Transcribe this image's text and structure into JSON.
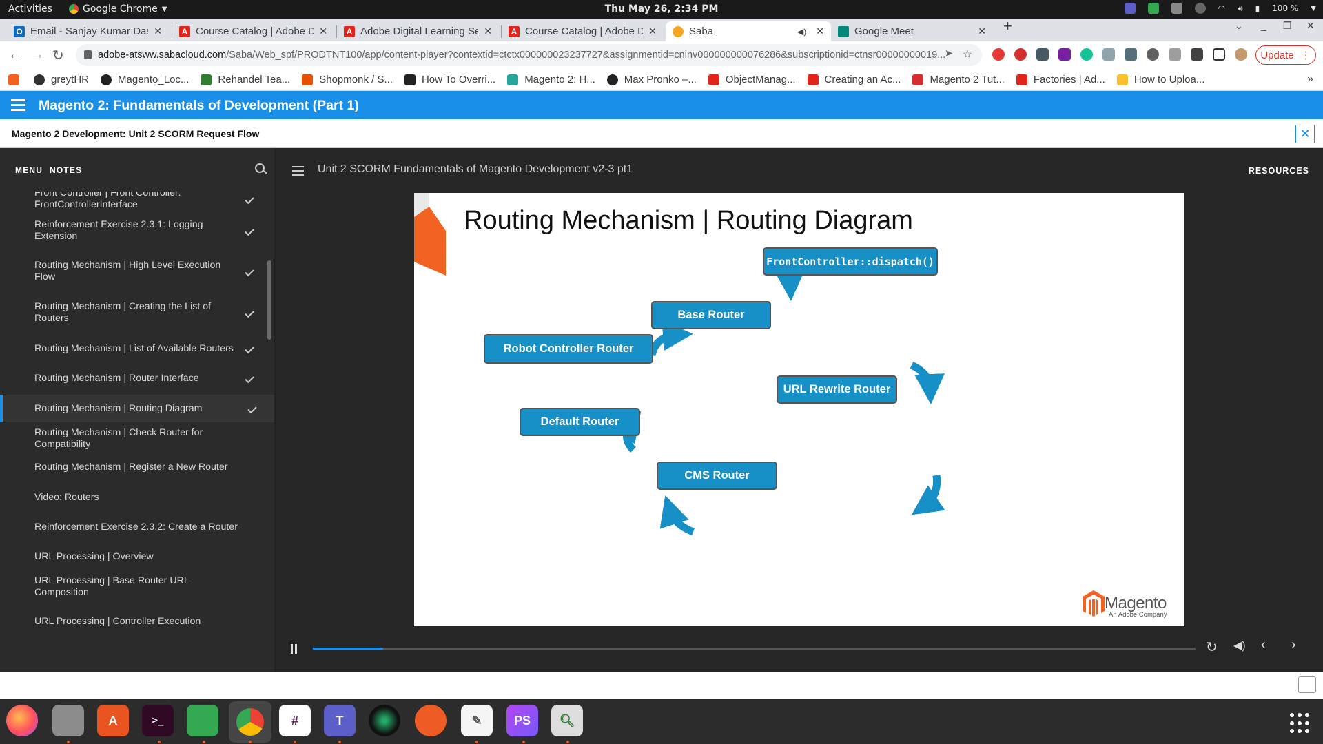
{
  "os": {
    "activities": "Activities",
    "app_name": "Google Chrome",
    "clock": "Thu May 26,  2:34 PM",
    "battery": "100 %"
  },
  "tabs": [
    {
      "title": "Email - Sanjay Kumar Das",
      "favicon_color": "#0f6cbd"
    },
    {
      "title": "Course Catalog | Adobe D",
      "favicon_color": "#e1251b"
    },
    {
      "title": "Adobe Digital Learning Se",
      "favicon_color": "#e1251b"
    },
    {
      "title": "Course Catalog | Adobe D",
      "favicon_color": "#e1251b"
    },
    {
      "title": "Saba",
      "favicon_color": "#f4a522",
      "active": true
    },
    {
      "title": "Google Meet",
      "favicon_color": "#00897b"
    }
  ],
  "toolbar": {
    "url_host": "adobe-atsww.sabacloud.com",
    "url_path": "/Saba/Web_spf/PRODTNT100/app/content-player?contextid=ctctx000000023237727&assignmentid=cninv000000000076286&subscriptionid=ctnsr00000000019...",
    "update_label": "Update"
  },
  "bookmarks": [
    {
      "label": "greytHR",
      "color": "#333"
    },
    {
      "label": "Magento_Loc...",
      "color": "#222"
    },
    {
      "label": "Rehandel Tea...",
      "color": "#2e7d32"
    },
    {
      "label": "Shopmonk / S...",
      "color": "#e65100"
    },
    {
      "label": "How To Overri...",
      "color": "#222"
    },
    {
      "label": "Magento 2: H...",
      "color": "#26a69a"
    },
    {
      "label": "Max Pronko –...",
      "color": "#222"
    },
    {
      "label": "ObjectManag...",
      "color": "#e1251b"
    },
    {
      "label": "Creating an Ac...",
      "color": "#e1251b"
    },
    {
      "label": "Magento 2 Tut...",
      "color": "#d32f2f"
    },
    {
      "label": "Factories | Ad...",
      "color": "#e1251b"
    },
    {
      "label": "How to Uploa...",
      "color": "#fbc02d"
    }
  ],
  "lms": {
    "course_title": "Magento 2: Fundamentals of Development (Part 1)",
    "module_title": "Magento 2 Development: Unit 2 SCORM Request Flow",
    "close_icon": "✕"
  },
  "sidebar": {
    "tab_menu": "MENU",
    "tab_notes": "NOTES",
    "items": [
      {
        "label": "Front Controller | Front Controller: FrontControllerInterface",
        "done": true
      },
      {
        "label": "Reinforcement Exercise 2.3.1: Logging Extension",
        "done": true
      },
      {
        "label": "Routing Mechanism | High Level Execution Flow",
        "done": true
      },
      {
        "label": "Routing Mechanism | Creating the List of Routers",
        "done": true
      },
      {
        "label": "Routing Mechanism | List of Available Routers",
        "done": true
      },
      {
        "label": "Routing Mechanism | Router Interface",
        "done": true
      },
      {
        "label": "Routing Mechanism | Routing Diagram",
        "done": true,
        "active": true
      },
      {
        "label": "Routing Mechanism | Check Router for Compatibility",
        "done": false
      },
      {
        "label": "Routing Mechanism | Register a New Router",
        "done": false
      },
      {
        "label": "Video: Routers",
        "done": false
      },
      {
        "label": "Reinforcement Exercise 2.3.2: Create a Router",
        "done": false
      },
      {
        "label": "URL Processing | Overview",
        "done": false
      },
      {
        "label": "URL Processing | Base Router URL Composition",
        "done": false
      },
      {
        "label": "URL Processing | Controller Execution",
        "done": false
      }
    ]
  },
  "player": {
    "title": "Unit 2 SCORM Fundamentals of Magento Development v2-3 pt1",
    "resources": "RESOURCES",
    "progress": 0.08
  },
  "slide": {
    "title": "Routing Mechanism | Routing Diagram",
    "nodes": {
      "dispatch": "FrontController::dispatch()",
      "base": "Base Router",
      "robot": "Robot Controller Router",
      "url_rewrite": "URL Rewrite Router",
      "default": "Default Router",
      "cms": "CMS Router"
    },
    "logo_text": "Magento",
    "logo_sub": "An Adobe Company",
    "accent_color": "#1690c7",
    "brand_color": "#f26322"
  }
}
